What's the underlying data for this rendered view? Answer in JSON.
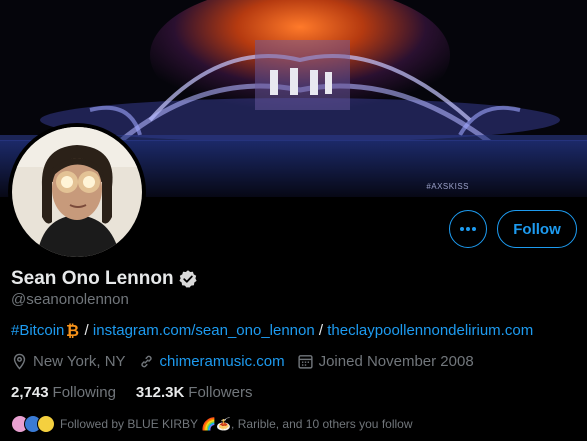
{
  "banner": {
    "tag": "#AXSKISS"
  },
  "profile": {
    "name": "Sean Ono Lennon",
    "handle": "@seanonolennon",
    "bio": {
      "hashtag": "#Bitcoin",
      "sep": "/",
      "link1": "instagram.com/sean_ono_lennon",
      "link2": "theclaypoollennondelirium.com"
    },
    "location": "New York, NY",
    "website": "chimeramusic.com",
    "joined": "Joined November 2008",
    "following_count": "2,743",
    "following_label": "Following",
    "followers_count": "312.3K",
    "followers_label": "Followers",
    "followed_by": "Followed by BLUE KIRBY 🌈🍝, Rarible, and 10 others you follow"
  },
  "actions": {
    "follow_label": "Follow"
  },
  "icons": {
    "more": "more-horizontal-icon",
    "verified": "verified-badge-icon",
    "location": "location-pin-icon",
    "link": "link-icon",
    "calendar": "calendar-icon",
    "bitcoin": "bitcoin-icon"
  },
  "colors": {
    "accent": "#1d9bf0",
    "muted": "#71767b",
    "text": "#e7e9ea",
    "bitcoin": "#f7931a"
  }
}
